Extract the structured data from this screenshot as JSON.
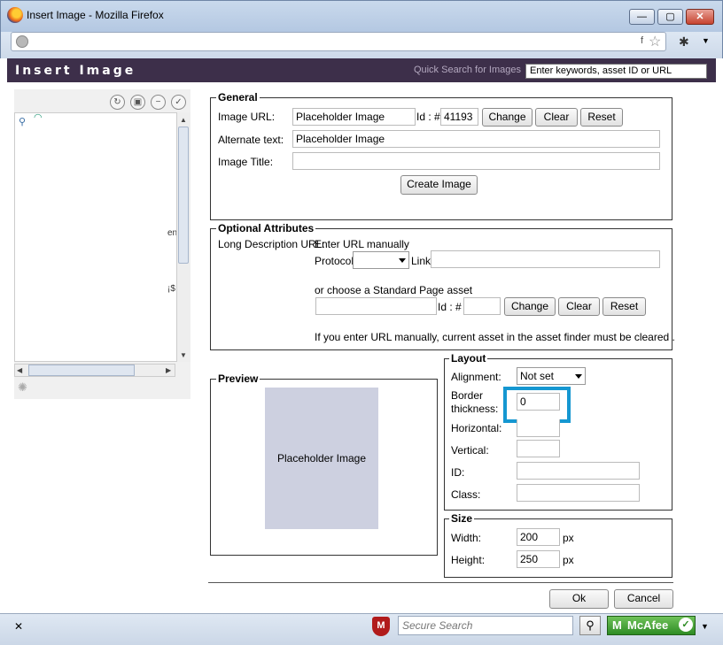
{
  "window": {
    "title": "Insert Image - Mozilla Firefox",
    "minimize": "—",
    "maximize": "▢",
    "close": "✕",
    "url": ""
  },
  "dialog": {
    "title": "Insert Image",
    "quick_search_label": "Quick Search for Images",
    "quick_search_placeholder": "Enter keywords, asset ID or URL",
    "tree_fragment_1": "en",
    "tree_fragment_2": "¡$"
  },
  "general": {
    "legend": "General",
    "image_url_label": "Image URL:",
    "image_url_value": "Placeholder Image",
    "id_label": "Id : #",
    "id_value": "41193",
    "change": "Change",
    "clear": "Clear",
    "reset": "Reset",
    "alt_label": "Alternate text:",
    "alt_value": "Placeholder Image",
    "title_label": "Image Title:",
    "title_value": "",
    "create_button": "Create Image"
  },
  "optional": {
    "legend": "Optional Attributes",
    "long_desc_label": "Long Description URL:",
    "enter_manually": "Enter URL manually",
    "protocol_label": "Protocol",
    "protocol_value": "",
    "link_label": "Link",
    "link_value": "",
    "choose_text": "or choose a Standard Page asset",
    "asset_value": "",
    "id_label": "Id : #",
    "id_value": "",
    "change": "Change",
    "clear": "Clear",
    "reset": "Reset",
    "note": "If you enter URL manually, current asset in the asset finder must be cleared ."
  },
  "preview": {
    "legend": "Preview",
    "placeholder": "Placeholder Image"
  },
  "layout": {
    "legend": "Layout",
    "alignment_label": "Alignment:",
    "alignment_value": "Not set",
    "border_label_1": "Border",
    "border_label_2": "thickness:",
    "border_value": "0",
    "horizontal_label": "Horizontal:",
    "horizontal_value": "",
    "vertical_label": "Vertical:",
    "vertical_value": "",
    "id_label": "ID:",
    "id_value": "",
    "class_label": "Class:",
    "class_value": ""
  },
  "size": {
    "legend": "Size",
    "width_label": "Width:",
    "width_value": "200",
    "height_label": "Height:",
    "height_value": "250",
    "unit": "px"
  },
  "actions": {
    "ok": "Ok",
    "cancel": "Cancel"
  },
  "statusbar": {
    "close": "✕",
    "mcafee_shield": "M",
    "search_placeholder": "Secure Search",
    "mcafee_label": "McAfee",
    "check": "✓"
  }
}
